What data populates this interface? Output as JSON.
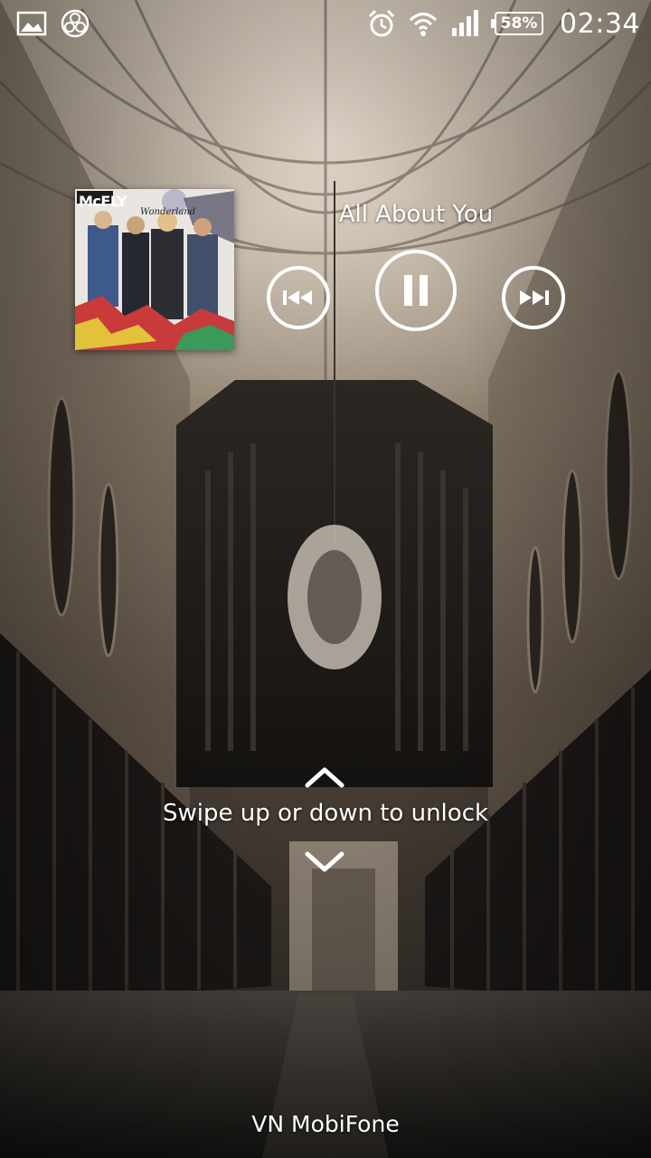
{
  "status_bar": {
    "left_icons": [
      "gallery-icon",
      "app-notification-icon"
    ],
    "right_icons": [
      "alarm-icon",
      "wifi-icon",
      "signal-icon"
    ],
    "battery": "58%",
    "time": "02:34"
  },
  "music_widget": {
    "album_art": {
      "band_logo": "McFLY",
      "album_title": "Wonderland"
    },
    "song_title": "All About You",
    "controls": {
      "previous": "previous-track-icon",
      "play_pause": "pause-icon",
      "next": "next-track-icon"
    }
  },
  "unlock": {
    "hint": "Swipe up or down to unlock"
  },
  "carrier": "VN MobiFone",
  "colors": {
    "text": "#ffffff",
    "wallpaper_tone": "#8a7c6c"
  }
}
